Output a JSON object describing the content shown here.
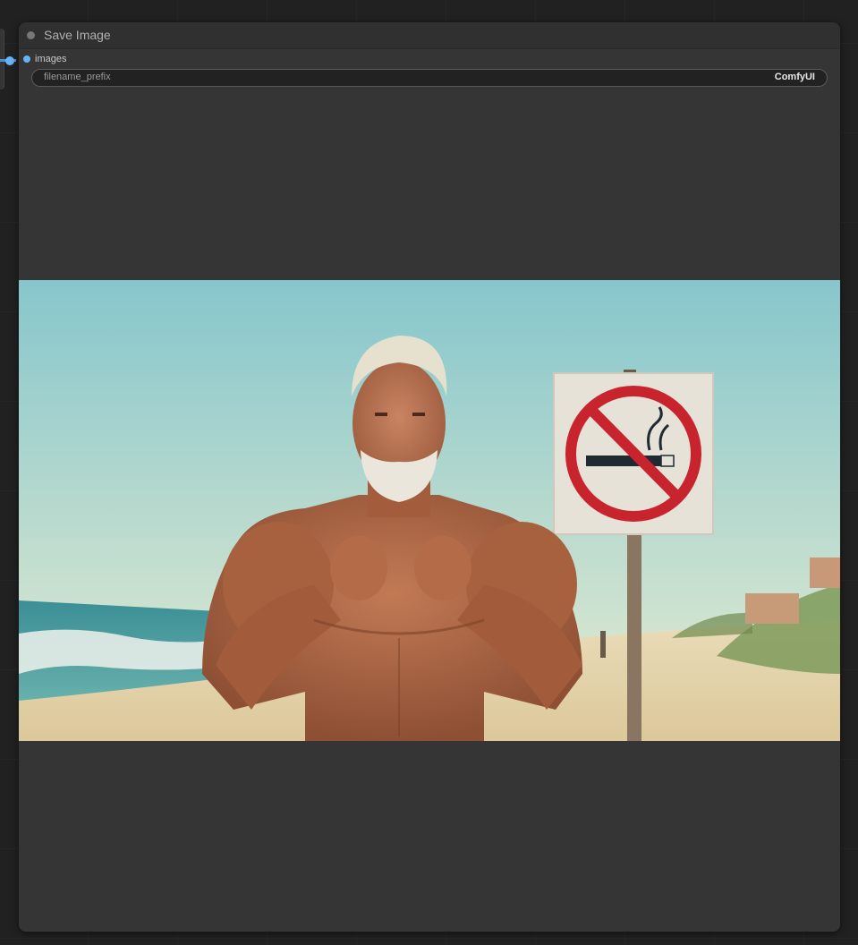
{
  "node": {
    "title": "Save Image",
    "input": {
      "label": "images"
    },
    "widget": {
      "name": "filename_prefix",
      "value": "ComfyUI"
    }
  },
  "preview": {
    "icon": "photo-preview",
    "colors": {
      "sky": "#8ccdd0",
      "sea": "#3f9a9c",
      "sand": "#e6d6b0",
      "skin": "#b8704e",
      "sign_red": "#c8242e",
      "wire": "#64b5f6"
    }
  }
}
